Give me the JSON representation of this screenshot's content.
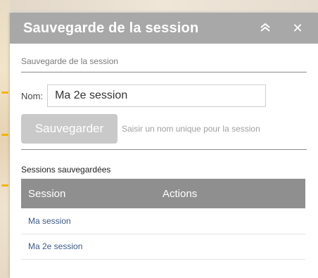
{
  "panel": {
    "title": "Sauvegarde de la session",
    "collapse_icon": "double-chevron-up-icon",
    "collapse_glyph": "≈",
    "close_icon": "close-icon",
    "close_glyph": "✕",
    "subtitle": "Sauvegarde de la session"
  },
  "form": {
    "name_label": "Nom:",
    "name_value": "Ma 2e session",
    "save_label": "Sauvegarder",
    "save_hint": "Saisir un nom unique pour la session"
  },
  "sessions": {
    "label": "Sessions sauvegardées",
    "columns": [
      "Session",
      "Actions"
    ],
    "rows": [
      {
        "name": "Ma session"
      },
      {
        "name": "Ma 2e session"
      }
    ]
  },
  "colors": {
    "header_bg": "#a8a8a8",
    "table_header_bg": "#8f8f8f",
    "link": "#3d5a86",
    "disabled_button": "#c9c9c9"
  }
}
